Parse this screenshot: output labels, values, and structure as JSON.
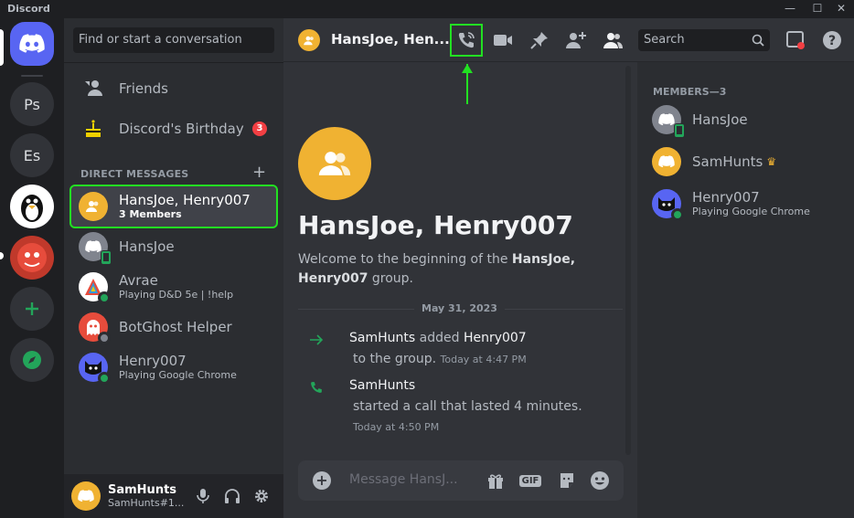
{
  "window": {
    "title": "Discord",
    "minimize": "—",
    "maximize": "☐",
    "close": "✕"
  },
  "servers": [
    {
      "label": "Ps"
    },
    {
      "label": "Es"
    }
  ],
  "sidebar": {
    "search_placeholder": "Find or start a conversation",
    "nav": [
      {
        "label": "Friends"
      },
      {
        "label": "Discord's Birthday",
        "badge": "3"
      }
    ],
    "dm_header": "DIRECT MESSAGES",
    "dms": [
      {
        "name": "HansJoe, Henry007",
        "sub": "3 Members"
      },
      {
        "name": "HansJoe",
        "sub": ""
      },
      {
        "name": "Avrae",
        "sub": "Playing D&D 5e | !help"
      },
      {
        "name": "BotGhost Helper",
        "sub": ""
      },
      {
        "name": "Henry007",
        "sub": "Playing Google Chrome"
      }
    ]
  },
  "user": {
    "name": "SamHunts",
    "tag": "SamHunts#1..."
  },
  "chat": {
    "title": "HansJoe, Hen...",
    "search_placeholder": "Search",
    "welcome_title": "HansJoe, Henry007",
    "welcome_pre": "Welcome to the beginning of the ",
    "welcome_bold": "HansJoe, Henry007",
    "welcome_post": " group.",
    "date": "May 31, 2023",
    "messages": [
      {
        "actor": "SamHunts",
        "verb": " added ",
        "target": "Henry007",
        "line2": "to the group.",
        "time": "Today at 4:47 PM"
      },
      {
        "actor": "SamHunts",
        "line2": "started a call that lasted 4 minutes.",
        "time": "Today at 4:50 PM"
      }
    ],
    "composer_placeholder": "Message HansJ...",
    "gif_label": "GIF"
  },
  "members": {
    "header": "MEMBERS—3",
    "list": [
      {
        "name": "HansJoe",
        "sub": ""
      },
      {
        "name": "SamHunts",
        "sub": "",
        "crown": "♛"
      },
      {
        "name": "Henry007",
        "sub": "Playing Google Chrome"
      }
    ]
  },
  "colors": {
    "accent": "#5865f2",
    "online": "#23a55a",
    "highlight": "#22e022",
    "group": "#f0b232",
    "danger": "#f23f43"
  }
}
